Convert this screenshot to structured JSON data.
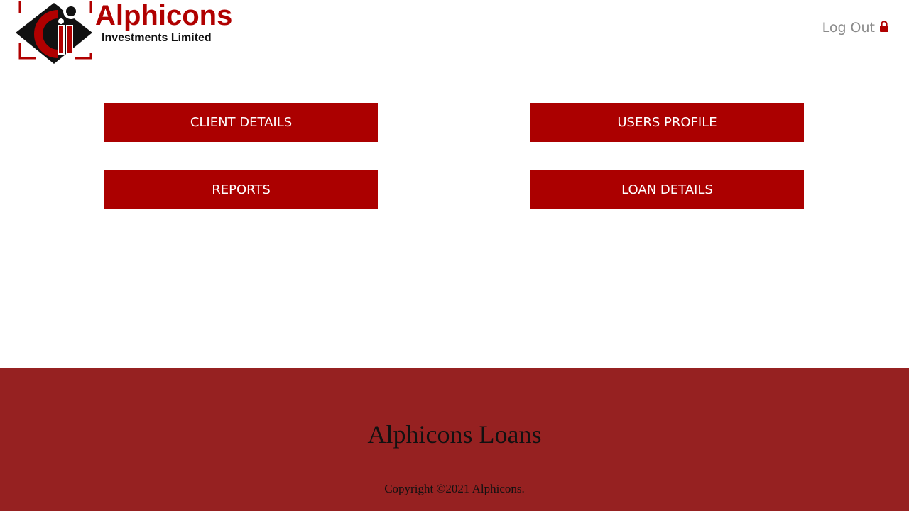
{
  "header": {
    "logo": {
      "brand_name": "Alphicons",
      "subtitle": "Investments Limited"
    },
    "logout_label": "Log Out",
    "logout_icon": "lock-icon"
  },
  "menu": {
    "client_details": "CLIENT DETAILS",
    "users_profile": "USERS PROFILE",
    "reports": "REPORTS",
    "loan_details": "LOAN DETAILS"
  },
  "footer": {
    "title": "Alphicons Loans",
    "copyright": "Copyright ©2021 Alphicons."
  },
  "colors": {
    "button_bg": "#ab0000",
    "footer_bg": "#962121",
    "brand_red": "#b00000"
  }
}
